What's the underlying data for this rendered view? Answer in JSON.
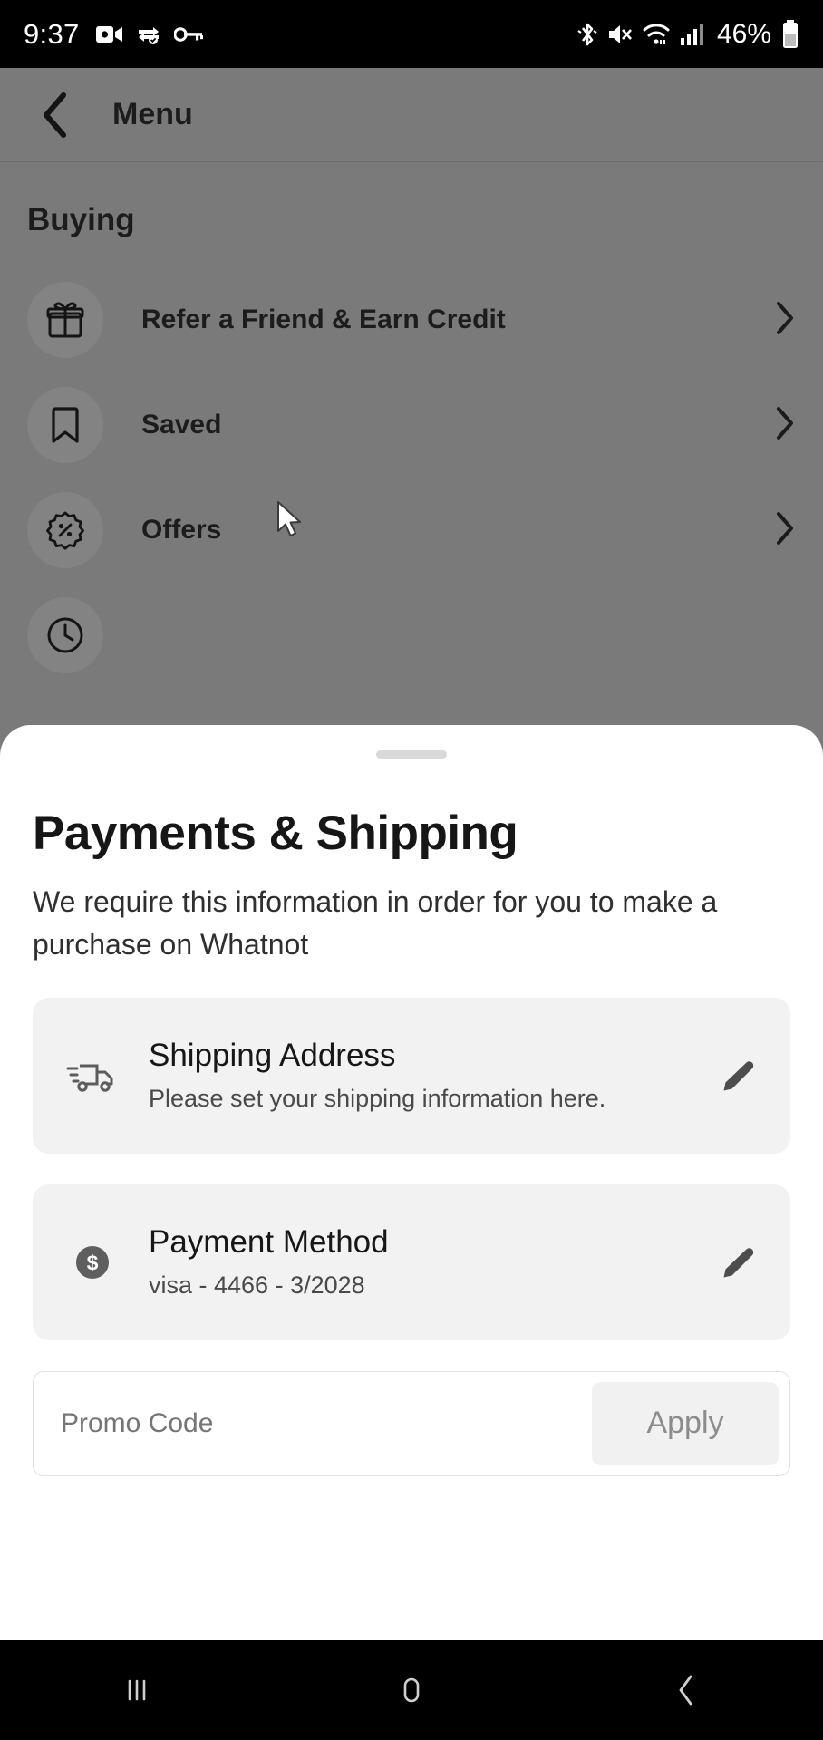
{
  "status_bar": {
    "time": "9:37",
    "battery_percent": "46%",
    "left_icons": [
      "video-camera-icon",
      "vpn-key-sync-icon",
      "key-icon"
    ],
    "right_icons": [
      "bluetooth-icon",
      "mute-icon",
      "wifi-icon",
      "cellular-signal-icon",
      "battery-icon"
    ]
  },
  "background_app": {
    "header": {
      "title": "Menu",
      "back_icon": "chevron-left-icon"
    },
    "section_title": "Buying",
    "rows": [
      {
        "label": "Refer a Friend & Earn Credit",
        "icon": "gift-icon"
      },
      {
        "label": "Saved",
        "icon": "bookmark-icon"
      },
      {
        "label": "Offers",
        "icon": "discount-badge-icon"
      }
    ]
  },
  "sheet": {
    "title": "Payments & Shipping",
    "subtitle": "We require this information in order for you to make a purchase on Whatnot",
    "cards": [
      {
        "title": "Shipping Address",
        "subtitle": "Please set your shipping information here.",
        "icon": "delivery-truck-icon",
        "edit_icon": "pencil-icon"
      },
      {
        "title": "Payment Method",
        "subtitle": "visa - 4466 - 3/2028",
        "icon": "dollar-circle-icon",
        "edit_icon": "pencil-icon"
      }
    ],
    "promo": {
      "placeholder": "Promo Code",
      "value": "",
      "apply_label": "Apply"
    }
  },
  "nav_bar": {
    "recents_icon": "recents-icon",
    "home_icon": "home-icon",
    "back_icon": "back-chevron-icon"
  },
  "colors": {
    "scrim": "#7a7a7a",
    "card_bg": "#f2f2f2",
    "sheet_bg": "#ffffff",
    "accent_text": "#161616"
  }
}
